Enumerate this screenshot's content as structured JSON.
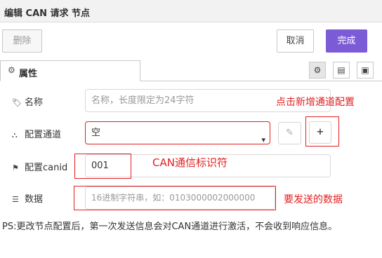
{
  "window": {
    "title": "编辑 CAN 请求 节点"
  },
  "toolbar": {
    "delete_label": "删除",
    "cancel_label": "取消",
    "done_label": "完成"
  },
  "tabs": {
    "properties_label": "属性",
    "icon_tabs": [
      {
        "name": "settings",
        "icon": "⚙"
      },
      {
        "name": "description",
        "icon": "▤"
      },
      {
        "name": "appearance",
        "icon": "▣"
      }
    ]
  },
  "form": {
    "name": {
      "label": "名称",
      "placeholder": "名称，长度限定为24字符",
      "value": ""
    },
    "channel": {
      "label": "配置通道",
      "selected": "空",
      "edit_icon": "✎",
      "add_icon": "+"
    },
    "canid": {
      "label": "配置canid",
      "value": "001"
    },
    "data": {
      "label": "数据",
      "placeholder": "16进制字符串，如：0103000002000000",
      "value": ""
    }
  },
  "annotations": {
    "add_channel": "点击新增通道配置",
    "can_identifier": "CAN通信标识符",
    "data_to_send": "要发送的数据"
  },
  "note": "PS:更改节点配置后，第一次发送信息会对CAN通道进行激活，不会收到响应信息。",
  "colors": {
    "accent": "#7c5bd6",
    "annotation": "#e32020"
  }
}
